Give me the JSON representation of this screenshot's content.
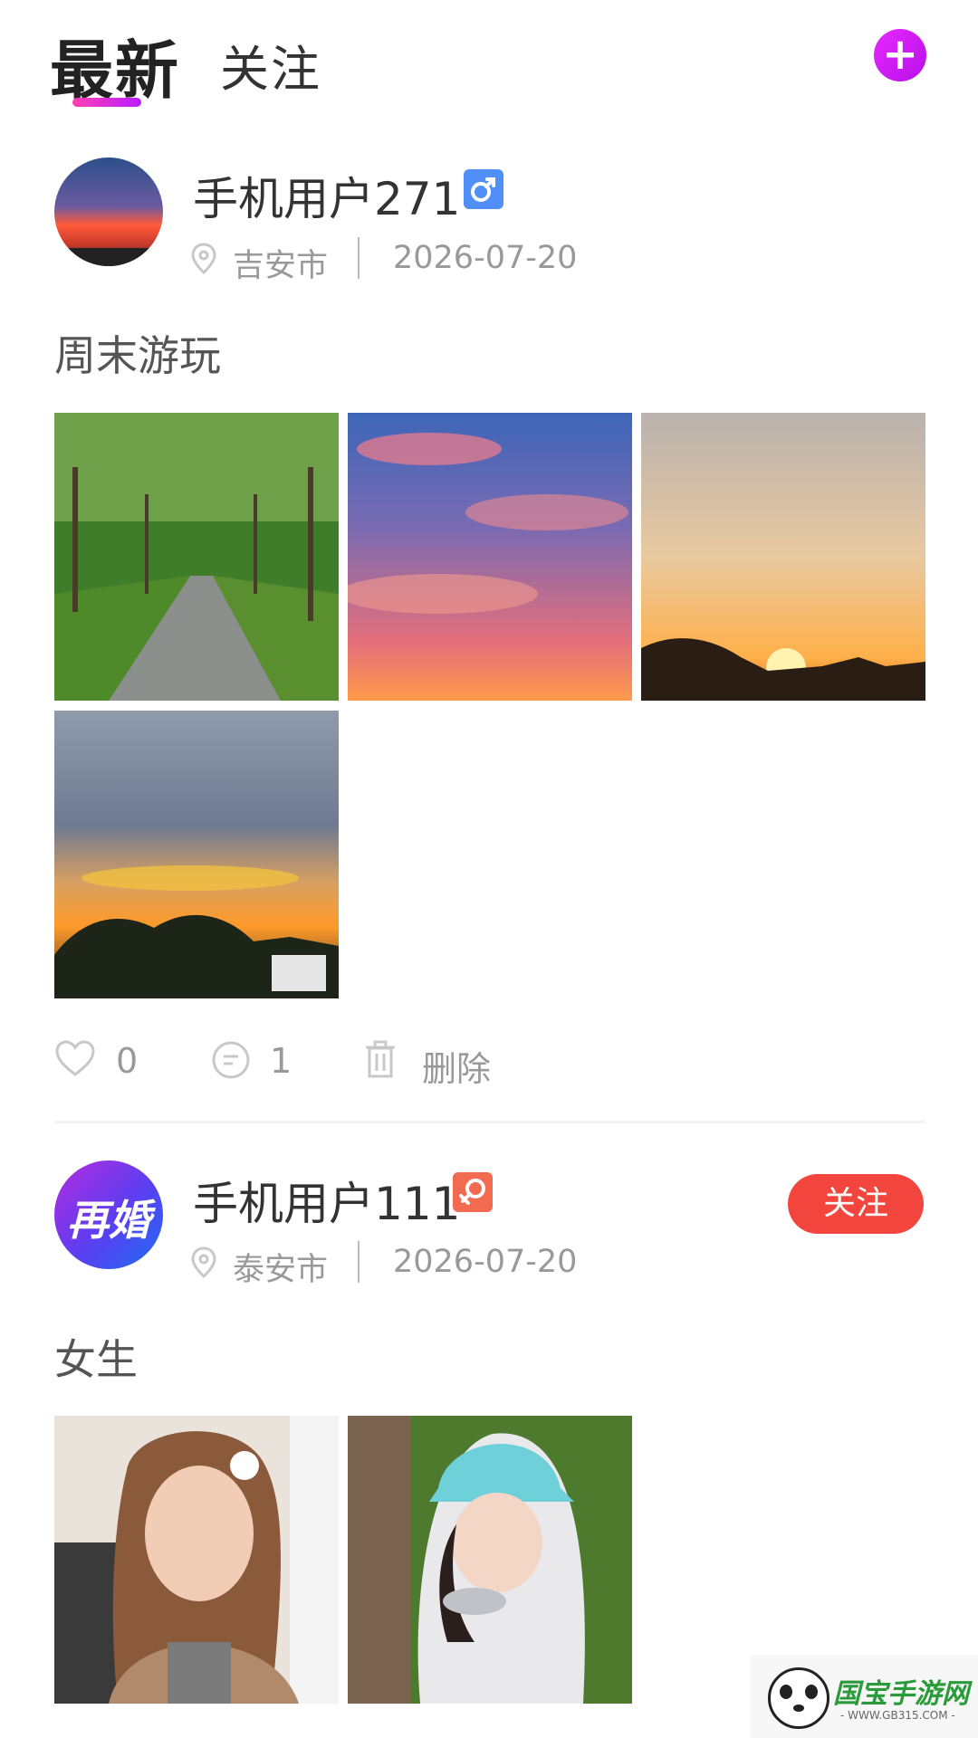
{
  "header": {
    "tabs": [
      {
        "label": "最新",
        "active": true
      },
      {
        "label": "关注",
        "active": false
      }
    ],
    "add_icon": "plus-icon",
    "accent_color": "#d21dff"
  },
  "posts": [
    {
      "username": "手机用户271",
      "gender_icon": "male-icon",
      "gender_color": "#4f8ff7",
      "location": "吉安市",
      "date": "2026-07-20",
      "text": "周末游玩",
      "photos": [
        "tree-lined-road-photo",
        "pink-clouds-sky-photo",
        "sunset-over-town-photo",
        "dusk-clouds-treeline-photo"
      ],
      "likes": "0",
      "comments": "1",
      "delete_label": "删除"
    },
    {
      "username": "手机用户111",
      "gender_icon": "female-icon",
      "gender_color": "#f26a4f",
      "avatar_text": "再婚",
      "location": "泰安市",
      "date": "2026-07-20",
      "text": "女生",
      "follow_label": "关注",
      "photos": [
        "girl-selfie-photo",
        "girl-bucket-hat-photo"
      ]
    }
  ],
  "watermark": {
    "name": "国宝手游网",
    "url": "- WWW.GB315.COM -"
  }
}
